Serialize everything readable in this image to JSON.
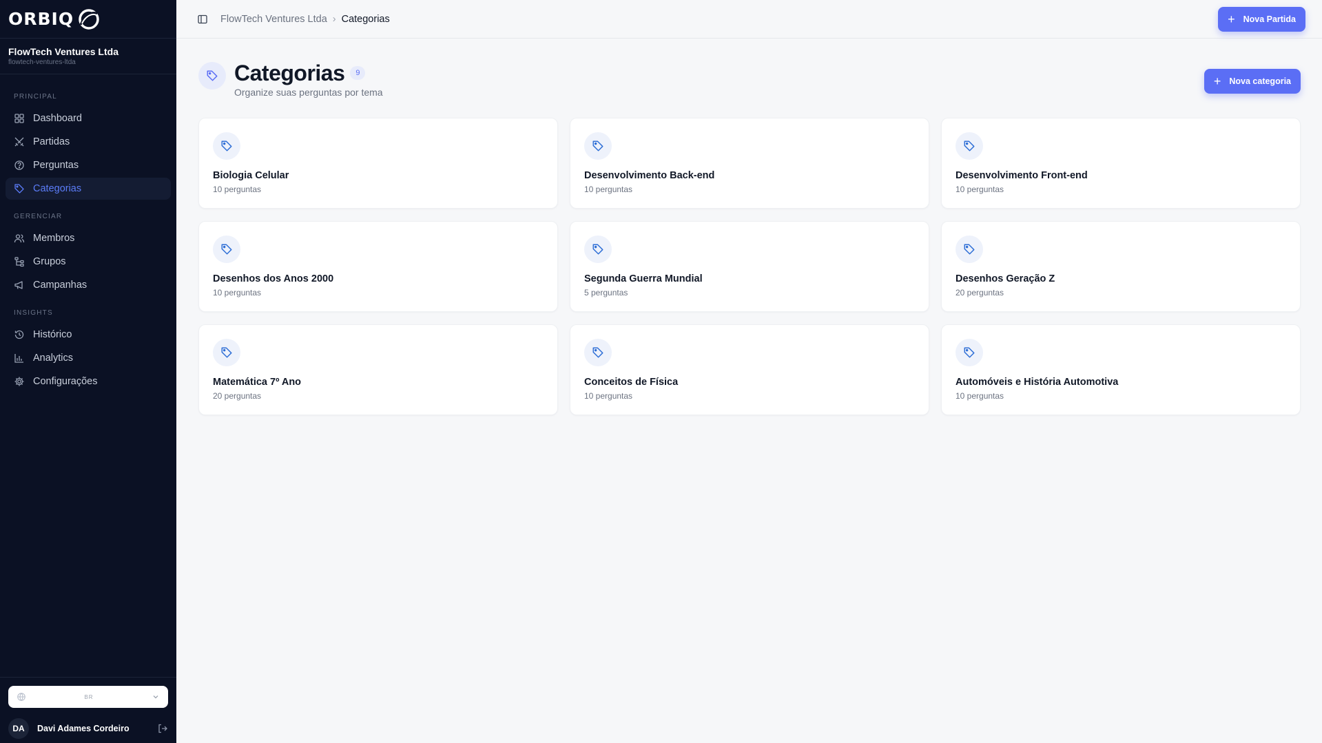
{
  "brand": {
    "name": "ORBIQ"
  },
  "org": {
    "name": "FlowTech Ventures Ltda",
    "slug": "flowtech-ventures-ltda"
  },
  "sidebar": {
    "sections": [
      {
        "label": "PRINCIPAL",
        "items": [
          {
            "label": "Dashboard",
            "icon": "grid-icon"
          },
          {
            "label": "Partidas",
            "icon": "swords-icon"
          },
          {
            "label": "Perguntas",
            "icon": "help-circle-icon"
          },
          {
            "label": "Categorias",
            "icon": "tag-icon",
            "active": true
          }
        ]
      },
      {
        "label": "GERENCIAR",
        "items": [
          {
            "label": "Membros",
            "icon": "users-icon"
          },
          {
            "label": "Grupos",
            "icon": "network-icon"
          },
          {
            "label": "Campanhas",
            "icon": "megaphone-icon"
          }
        ]
      },
      {
        "label": "INSIGHTS",
        "items": [
          {
            "label": "Histórico",
            "icon": "history-icon"
          },
          {
            "label": "Analytics",
            "icon": "bar-chart-icon"
          },
          {
            "label": "Configurações",
            "icon": "gear-icon"
          }
        ]
      }
    ]
  },
  "footer": {
    "language_value": "BR",
    "user_initials": "DA",
    "user_name": "Davi Adames Cordeiro"
  },
  "topbar": {
    "breadcrumb_org": "FlowTech Ventures Ltda",
    "breadcrumb_current": "Categorias",
    "new_match_label": "Nova Partida"
  },
  "page": {
    "title": "Categorias",
    "count": "9",
    "subtitle": "Organize suas perguntas por tema",
    "new_category_label": "Nova categoria"
  },
  "categories": [
    {
      "name": "Biologia Celular",
      "count": "10 perguntas"
    },
    {
      "name": "Desenvolvimento Back-end",
      "count": "10 perguntas"
    },
    {
      "name": "Desenvolvimento Front-end",
      "count": "10 perguntas"
    },
    {
      "name": "Desenhos dos Anos 2000",
      "count": "10 perguntas"
    },
    {
      "name": "Segunda Guerra Mundial",
      "count": "5 perguntas"
    },
    {
      "name": "Desenhos Geração Z",
      "count": "20 perguntas"
    },
    {
      "name": "Matemática 7º Ano",
      "count": "20 perguntas"
    },
    {
      "name": "Conceitos de Física",
      "count": "10 perguntas"
    },
    {
      "name": "Automóveis e História Automotiva",
      "count": "10 perguntas"
    }
  ],
  "colors": {
    "accent": "#5b6ef5",
    "sidebar_bg": "#0b1124",
    "active_text": "#5b7cf8"
  }
}
